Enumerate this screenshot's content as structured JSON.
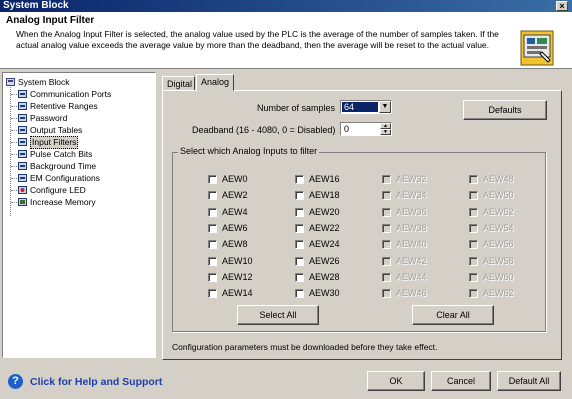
{
  "window": {
    "title": "System Block",
    "close_glyph": "×"
  },
  "header": {
    "title": "Analog Input Filter",
    "description": "When the Analog Input Filter is selected, the analog value used by the PLC is the average of the number of samples taken.  If the actual analog value exceeds the average value by more than the deadband, then the average will be reset to the actual value.",
    "icon": "analog-filter-icon"
  },
  "tree": {
    "root": "System Block",
    "items": [
      "Communication Ports",
      "Retentive Ranges",
      "Password",
      "Output Tables",
      "Input Filters",
      "Pulse Catch Bits",
      "Background Time",
      "EM Configurations",
      "Configure LED",
      "Increase Memory"
    ],
    "selected": "Input Filters"
  },
  "tabs": {
    "digital": "Digital",
    "analog": "Analog"
  },
  "form": {
    "samples_label": "Number of samples",
    "samples_value": "64",
    "deadband_label": "Deadband (16 - 4080, 0 = Disabled)",
    "deadband_value": "0",
    "defaults_button": "Defaults"
  },
  "group": {
    "title": "Select which Analog Inputs to filter",
    "columns": [
      {
        "enabled": true,
        "inputs": [
          "AEW0",
          "AEW2",
          "AEW4",
          "AEW6",
          "AEW8",
          "AEW10",
          "AEW12",
          "AEW14"
        ]
      },
      {
        "enabled": true,
        "inputs": [
          "AEW16",
          "AEW18",
          "AEW20",
          "AEW22",
          "AEW24",
          "AEW26",
          "AEW28",
          "AEW30"
        ]
      },
      {
        "enabled": false,
        "inputs": [
          "AEW32",
          "AEW34",
          "AEW36",
          "AEW38",
          "AEW40",
          "AEW42",
          "AEW44",
          "AEW46"
        ]
      },
      {
        "enabled": false,
        "inputs": [
          "AEW48",
          "AEW50",
          "AEW52",
          "AEW54",
          "AEW56",
          "AEW58",
          "AEW60",
          "AEW62"
        ]
      }
    ],
    "select_all": "Select All",
    "clear_all": "Clear All"
  },
  "note": "Configuration parameters must be downloaded before they take effect.",
  "footer": {
    "help_text": "Click for Help and Support",
    "help_glyph": "?",
    "ok": "OK",
    "cancel": "Cancel",
    "default_all": "Default All"
  }
}
